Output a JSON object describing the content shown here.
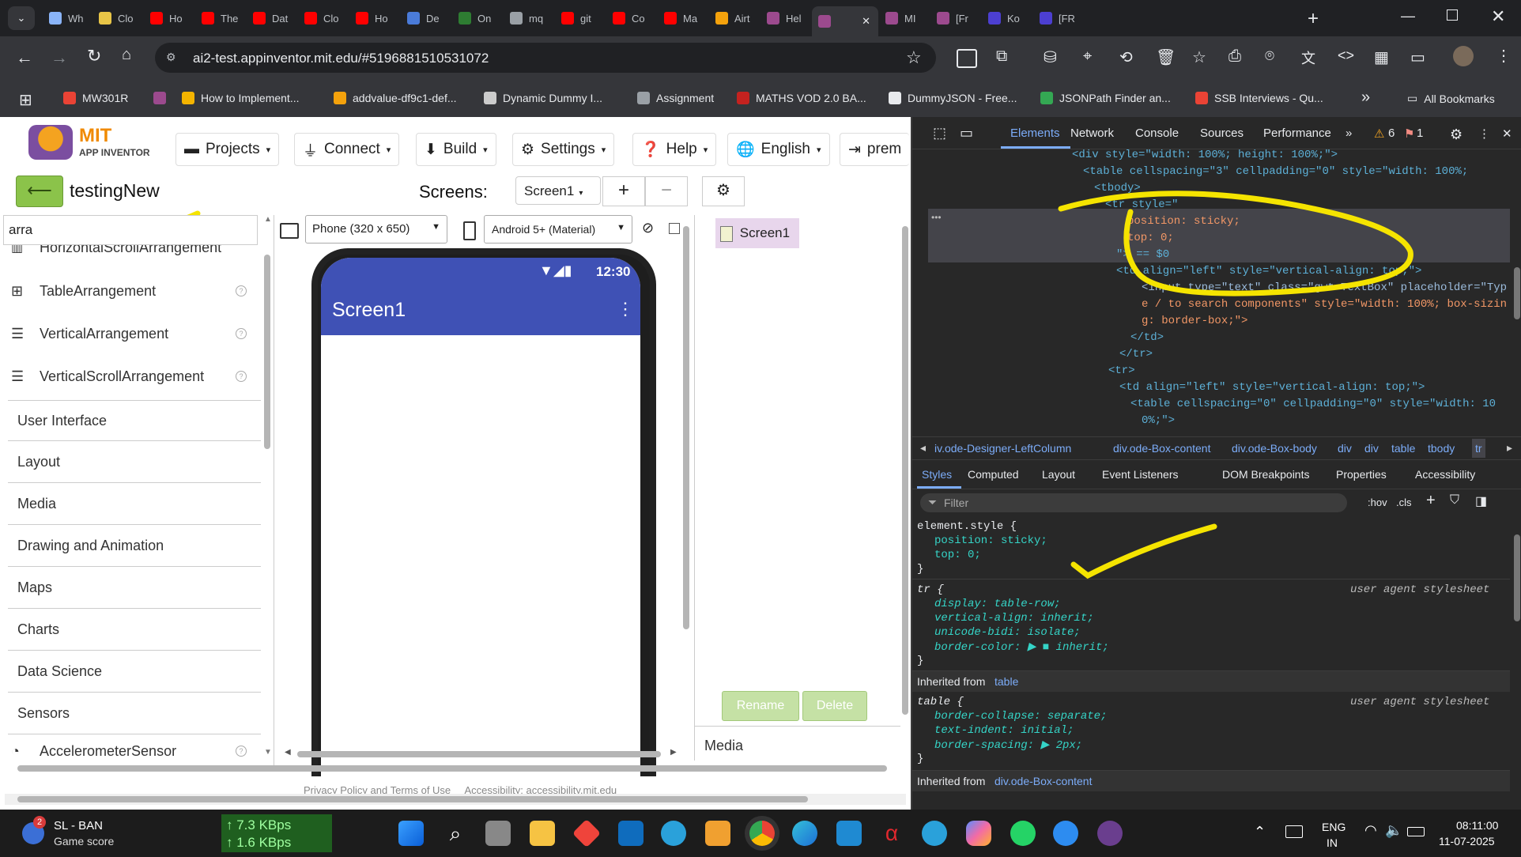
{
  "browser": {
    "tabs": [
      {
        "label": "Wh",
        "color": "#8ab4f8"
      },
      {
        "label": "Clo",
        "color": "#e8c547"
      },
      {
        "label": "Ho",
        "color": "#ff0000"
      },
      {
        "label": "The",
        "color": "#ff0000"
      },
      {
        "label": "Dat",
        "color": "#ff0000"
      },
      {
        "label": "Clo",
        "color": "#ff0000"
      },
      {
        "label": "Ho",
        "color": "#ff0000"
      },
      {
        "label": "De",
        "color": "#4a7bd9"
      },
      {
        "label": "On",
        "color": "#2e7d32"
      },
      {
        "label": "mq",
        "color": "#9aa0a6"
      },
      {
        "label": "git",
        "color": "#ff0000"
      },
      {
        "label": "Co",
        "color": "#ff0000"
      },
      {
        "label": "Ma",
        "color": "#ff0000"
      },
      {
        "label": "Airt",
        "color": "#f4a20c"
      },
      {
        "label": "Hel",
        "color": "#9c4a8e"
      },
      {
        "label": "",
        "color": "#9c4a8e"
      },
      {
        "label": "MI",
        "color": "#9c4a8e"
      },
      {
        "label": "[Fr",
        "color": "#9c4a8e"
      },
      {
        "label": "Ko",
        "color": "#4c3fd1"
      },
      {
        "label": "[FR",
        "color": "#4c3fd1"
      }
    ],
    "url": "ai2-test.appinventor.mit.edu/#5196881510531072",
    "bookmarks": [
      {
        "label": "MW301R",
        "color": "#ea4335"
      },
      {
        "label": "",
        "color": "#9c4a8e"
      },
      {
        "label": "How to Implement...",
        "color": "#f4b400"
      },
      {
        "label": "addvalue-df9c1-def...",
        "color": "#f4a20c"
      },
      {
        "label": "Dynamic Dummy I...",
        "color": "#cccccc"
      },
      {
        "label": "Assignment",
        "color": "#9aa0a6"
      },
      {
        "label": "MATHS VOD 2.0 BA...",
        "color": "#c5221f"
      },
      {
        "label": "DummyJSON - Free...",
        "color": "#e8eaed"
      },
      {
        "label": "JSONPath Finder an...",
        "color": "#34a853"
      },
      {
        "label": "SSB Interviews - Qu...",
        "color": "#ea4335"
      }
    ],
    "all_bookmarks": "All Bookmarks"
  },
  "app": {
    "logo_title": "MIT",
    "logo_subtitle": "APP INVENTOR",
    "menus": [
      "Projects",
      "Connect",
      "Build",
      "Settings",
      "Help",
      "English",
      "prem"
    ],
    "project_name": "testingNew",
    "screens_label": "Screens:",
    "screen_select": "Screen1",
    "search_value": "arra",
    "palette_cutoff": "HorizontalScrollArrangement",
    "palette_items": [
      "TableArrangement",
      "VerticalArrangement",
      "VerticalScrollArrangement"
    ],
    "categories": [
      "User Interface",
      "Layout",
      "Media",
      "Drawing and Animation",
      "Maps",
      "Charts",
      "Data Science",
      "Sensors"
    ],
    "sensor_item": "AccelerometerSensor",
    "phone_size": "Phone (320 x 650)",
    "theme": "Android 5+ (Material)",
    "status_time": "12:30",
    "screen_title": "Screen1",
    "tree_item": "Screen1",
    "rename": "Rename",
    "delete": "Delete",
    "media_label": "Media",
    "footer": "Privacy Policy and Terms of Use     Accessibility: accessibility.mit.edu"
  },
  "devtools": {
    "tabs": [
      "Elements",
      "Network",
      "Console",
      "Sources",
      "Performance"
    ],
    "warnings": "6",
    "errors": "1",
    "dom_lines": [
      "<div style=\"width: 100%; height: 100%;\">",
      "<table cellspacing=\"3\" cellpadding=\"0\" style=\"width: 100%;",
      "<tbody>",
      "<tr style=\"",
      "position: sticky;",
      "top: 0;",
      "\"> == $0",
      "<td align=\"left\" style=\"vertical-align: top;\">",
      "<input type=\"text\" class=\"gwt-TextBox\" placeholder=\"Typ",
      "e / to search components\" style=\"width: 100%; box-sizin",
      "g: border-box;\">",
      "</td>",
      "</tr>",
      "<tr>",
      "<td align=\"left\" style=\"vertical-align: top;\">",
      "<table cellspacing=\"0\" cellpadding=\"0\" style=\"width: 10",
      "0%;\">"
    ],
    "breadcrumbs": [
      "iv.ode-Designer-LeftColumn",
      "div.ode-Box-content",
      "div.ode-Box-body",
      "div",
      "div",
      "table",
      "tbody",
      "tr"
    ],
    "style_tabs": [
      "Styles",
      "Computed",
      "Layout",
      "Event Listeners",
      "DOM Breakpoints",
      "Properties",
      "Accessibility"
    ],
    "filter_placeholder": "Filter",
    "hov": ":hov",
    "cls": ".cls",
    "rules": {
      "element_selector": "element.style {",
      "element_props": [
        "position: sticky;",
        "top: 0;"
      ],
      "tr_selector": "tr {",
      "tr_source": "user agent stylesheet",
      "tr_props": [
        "display: table-row;",
        "vertical-align: inherit;",
        "unicode-bidi: isolate;",
        "border-color: ▶ ■ inherit;"
      ],
      "inherited_table": "Inherited from",
      "inherited_table_link": "table",
      "table_selector": "table {",
      "table_source": "user agent stylesheet",
      "table_props": [
        "border-collapse: separate;",
        "text-indent: initial;",
        "border-spacing: ▶ 2px;"
      ],
      "inherited_box": "Inherited from",
      "inherited_box_link": "div.ode-Box-content",
      "close": "}"
    }
  },
  "taskbar": {
    "weather_badge": "2",
    "weather_title": "SL - BAN",
    "weather_sub": "Game score",
    "net_up": "↑ 7.3 KBps",
    "net_down": "↑ 1.6 KBps",
    "lang": "ENG",
    "region": "IN",
    "time": "08:11:00",
    "date": "11-07-2025"
  }
}
